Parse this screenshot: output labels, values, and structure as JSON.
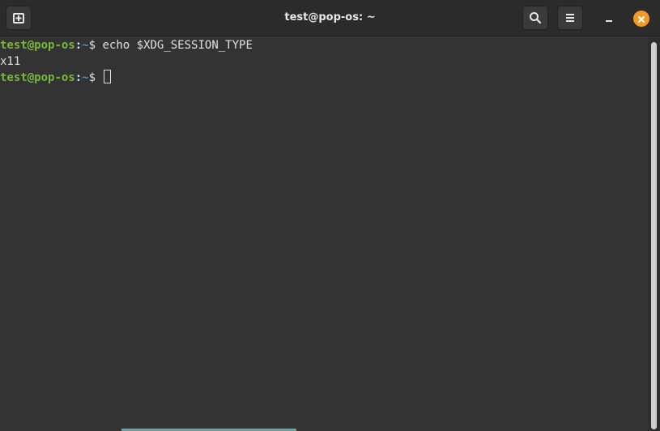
{
  "window": {
    "title": "test@pop-os: ~"
  },
  "header": {
    "new_tab_icon": "new-tab-icon",
    "search_icon": "search-icon",
    "menu_icon": "hamburger-menu-icon",
    "minimize_icon": "minimize-icon",
    "close_icon": "close-icon"
  },
  "terminal": {
    "lines": [
      {
        "user": "test@pop-os",
        "colon": ":",
        "path": "~",
        "dollar": "$",
        "command": " echo $XDG_SESSION_TYPE"
      },
      {
        "output": "x11"
      },
      {
        "user": "test@pop-os",
        "colon": ":",
        "path": "~",
        "dollar": "$",
        "command": " "
      }
    ]
  },
  "colors": {
    "background": "#333333",
    "titlebar": "#2b2b2b",
    "prompt_user": "#78b73c",
    "prompt_path": "#4a8fd6",
    "close_button": "#f29a28"
  }
}
